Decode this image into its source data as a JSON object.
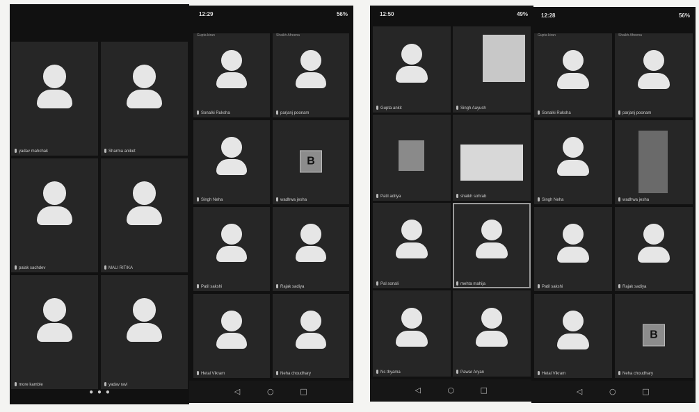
{
  "panels": [
    {
      "status": null,
      "tiles": [
        {
          "name": "yadav mahchak",
          "type": "avatar"
        },
        {
          "name": "Sharma aniket",
          "type": "avatar"
        },
        {
          "name": "palak sachdev",
          "type": "avatar"
        },
        {
          "name": "MALI RITIKA",
          "type": "avatar"
        },
        {
          "name": "more kamble",
          "type": "avatar"
        },
        {
          "name": "yadav ravi",
          "type": "avatar"
        }
      ],
      "pager": "• • •",
      "nav": null
    },
    {
      "status": {
        "time": "12:29",
        "battery": "56%"
      },
      "top_names": [
        "Gupta kiran",
        "Shaikh Afreena"
      ],
      "tiles": [
        {
          "name": "Sonalki Ruksha",
          "type": "avatar"
        },
        {
          "name": "parjanj poonam",
          "type": "avatar"
        },
        {
          "name": "Singh Neha",
          "type": "avatar"
        },
        {
          "name": "wadhwa jesha",
          "type": "badge",
          "badge": "B"
        },
        {
          "name": "Patil sakshi",
          "type": "avatar"
        },
        {
          "name": "Rajak sadiya",
          "type": "avatar"
        },
        {
          "name": "Hetal Vikram",
          "type": "avatar"
        },
        {
          "name": "Neha choudhary",
          "type": "avatar"
        }
      ],
      "nav": [
        "◁",
        "○",
        "□"
      ]
    },
    {
      "status": {
        "time": "12:50",
        "battery": "49%"
      },
      "tiles": [
        {
          "name": "Gupta ankit",
          "type": "avatar"
        },
        {
          "name": "Singh Aayush",
          "type": "document"
        },
        {
          "name": "Patil aditya",
          "type": "photo"
        },
        {
          "name": "shaikh sohrab",
          "type": "hands"
        },
        {
          "name": "Pal sonali",
          "type": "avatar"
        },
        {
          "name": "mehta mahija",
          "type": "avatar",
          "selected": true
        },
        {
          "name": "Ns thyama",
          "type": "avatar"
        },
        {
          "name": "Pawar Aryan",
          "type": "avatar"
        }
      ],
      "nav": [
        "◁",
        "○",
        "□"
      ]
    },
    {
      "status": {
        "time": "12:28",
        "battery": "56%"
      },
      "top_names": [
        "Gupta kiran",
        "Shaikh Afreena"
      ],
      "tiles": [
        {
          "name": "Sonalki Ruksha",
          "type": "avatar"
        },
        {
          "name": "parjanj poonam",
          "type": "avatar"
        },
        {
          "name": "Singh Neha",
          "type": "avatar"
        },
        {
          "name": "wadhwa jesha",
          "type": "person"
        },
        {
          "name": "Patil sakshi",
          "type": "avatar"
        },
        {
          "name": "Rajak sadiya",
          "type": "avatar"
        },
        {
          "name": "Hetal Vikram",
          "type": "avatar"
        },
        {
          "name": "Neha choudhary",
          "type": "badge",
          "badge": "B"
        }
      ],
      "nav": [
        "◁",
        "○",
        "□"
      ]
    }
  ]
}
